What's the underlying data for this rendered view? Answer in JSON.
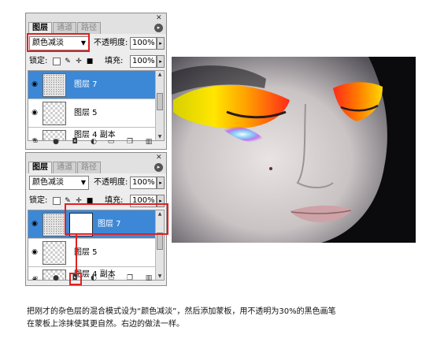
{
  "panels": [
    {
      "tabs": [
        "图层",
        "通道",
        "路径"
      ],
      "blend_mode": "颜色减淡",
      "opacity_label": "不透明度:",
      "opacity_value": "100%",
      "lock_label": "锁定:",
      "fill_label": "填充:",
      "fill_value": "100%",
      "layers": [
        {
          "name": "图层 7",
          "selected": true
        },
        {
          "name": "图层 5",
          "selected": false
        },
        {
          "name": "图层 4 副本",
          "selected": false
        }
      ]
    },
    {
      "tabs": [
        "图层",
        "通道",
        "路径"
      ],
      "blend_mode": "颜色减淡",
      "opacity_label": "不透明度:",
      "opacity_value": "100%",
      "lock_label": "锁定:",
      "fill_label": "填充:",
      "fill_value": "100%",
      "layers": [
        {
          "name": "图层 7",
          "selected": true
        },
        {
          "name": "图层 5",
          "selected": false
        },
        {
          "name": "图层 4 副本",
          "selected": false
        }
      ]
    }
  ],
  "caption": {
    "line1": "把刚才的杂色层的混合模式设为“颜色减淡”，然后添加蒙板，用不透明为30%的黑色画笔",
    "line2": "在蒙板上涂抹使其更自然。右边的做法一样。"
  },
  "colors": {
    "selected_layer": "#3d88d6",
    "highlight": "#e02020"
  },
  "icons": [
    "eye-icon",
    "link-icon",
    "fx-icon",
    "mask-icon",
    "adjustment-icon",
    "folder-icon",
    "new-layer-icon",
    "trash-icon",
    "lock-icon",
    "brush-icon",
    "move-icon",
    "checker-icon",
    "panel-menu-icon",
    "close-icon"
  ]
}
